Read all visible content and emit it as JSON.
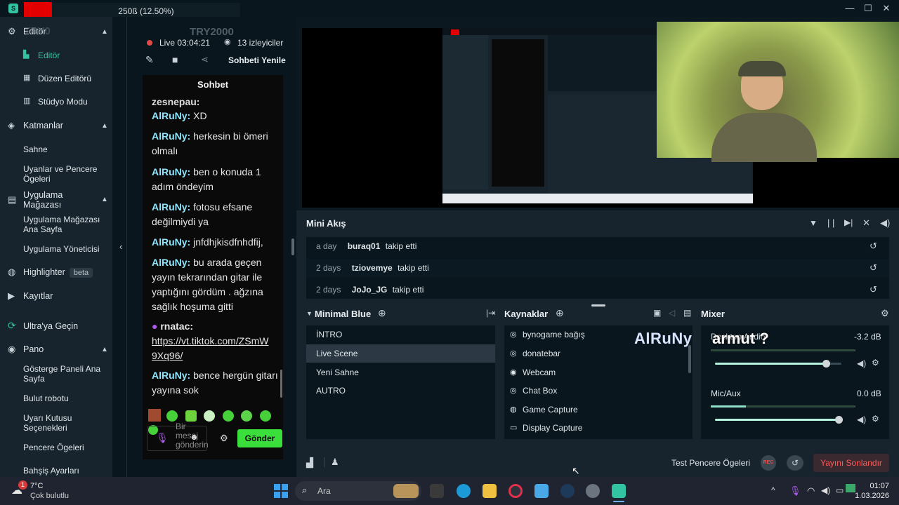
{
  "topbar": {
    "progress_text": "250ß (12.50%)"
  },
  "sidebar": {
    "editor_section": "Editör",
    "editor_overlay": "TRY0",
    "editor_items": [
      "Editör",
      "Düzen Editörü",
      "Stüdyo Modu"
    ],
    "layers_section": "Katmanlar",
    "layers_items": [
      "Sahne",
      "Uyanlar ve Pencere Ögeleri"
    ],
    "appstore_section": "Uygulama Mağazası",
    "appstore_items": [
      "Uygulama Mağazası Ana Sayfa",
      "Uygulama Yöneticisi"
    ],
    "highlighter": "Highlighter",
    "highlighter_badge": "beta",
    "recordings": "Kayıtlar",
    "ultra": "Ultra'ya Geçin",
    "dashboard_section": "Pano",
    "dashboard_items": [
      "Gösterge Paneli Ana Sayfa",
      "Bulut robotu",
      "Uyarı Kutusu Seçenekleri",
      "Pencere Ögeleri",
      "Bahşiş Ayarları"
    ]
  },
  "chat_header": {
    "channel": "TRY2000",
    "live_time": "Live 03:04:21",
    "viewers": "13 izleyiciler",
    "refresh": "Sohbeti Yenile",
    "title": "Sohbet"
  },
  "chat": {
    "partial_top": "zesnepau:",
    "messages": [
      {
        "user": "AlRuNy:",
        "text": " XD"
      },
      {
        "user": "AlRuNy:",
        "text": " herkesin bi ömeri olmalı"
      },
      {
        "user": "AlRuNy:",
        "text": " ben o konuda 1 adım öndeyim"
      },
      {
        "user": "AlRuNy:",
        "text": " fotosu efsane değilmiydi ya"
      },
      {
        "user": "AlRuNy:",
        "text": " jnfdhjkisdfnhdfij,"
      },
      {
        "user": "AlRuNy:",
        "text": " bu arada geçen yayın tekrarından gitar ile yaptığını gördüm . ağzına sağlık hoşuma gitti"
      }
    ],
    "link_user": "rnatac:",
    "link_text": "https://vt.tiktok.com/ZSmW9Xq96/",
    "last_user": "AlRuNy:",
    "last_text": " bence hergün gitarı yayına sok",
    "input_placeholder": "Bir mesaj gönderin",
    "send": "Gönder"
  },
  "mini_feed": {
    "title": "Mini Akış",
    "events": [
      {
        "time": "a day",
        "user": "buraq01",
        "action": "takip etti"
      },
      {
        "time": "2 days",
        "user": "tziovemye",
        "action": "takip etti"
      },
      {
        "time": "2 days",
        "user": "JoJo_JG",
        "action": "takip etti"
      }
    ]
  },
  "scenes": {
    "title": "Minimal Blue",
    "items": [
      "İNTRO",
      "Live Scene",
      "Yeni Sahne",
      "AUTRO"
    ],
    "selected_index": 1
  },
  "sources": {
    "title": "Kaynaklar",
    "items": [
      {
        "label": "bynogame bağış",
        "icon": "globe-icon"
      },
      {
        "label": "donatebar",
        "icon": "globe-icon"
      },
      {
        "label": "Webcam",
        "icon": "webcam-icon"
      },
      {
        "label": "Chat Box",
        "icon": "globe-icon"
      },
      {
        "label": "Game Capture",
        "icon": "gamepad-icon"
      },
      {
        "label": "Display Capture",
        "icon": "monitor-icon"
      }
    ]
  },
  "mixer": {
    "title": "Mixer",
    "channels": [
      {
        "name": "Desktop Audio",
        "db": "-3.2 dB",
        "level": 0.88
      },
      {
        "name": "Mic/Aux",
        "db": "0.0 dB",
        "level": 0.98
      }
    ]
  },
  "overlay_alert": {
    "user": "AlRuNy",
    "message": "armut ?"
  },
  "footer": {
    "test_widgets": "Test Pencere Ögeleri",
    "rec": "REC",
    "end_stream": "Yayını Sonlandır"
  },
  "taskbar": {
    "weather_temp": "7°C",
    "weather_desc": "Çok bulutlu",
    "notif_count": "1",
    "search": "Ara",
    "time": "01:07",
    "date": "1.03.2026"
  },
  "colors": {
    "accent": "#31c3a2",
    "send": "#3bdf3b",
    "end_stream": "#ff5a5a",
    "chat_user": "#8fe6ff"
  }
}
